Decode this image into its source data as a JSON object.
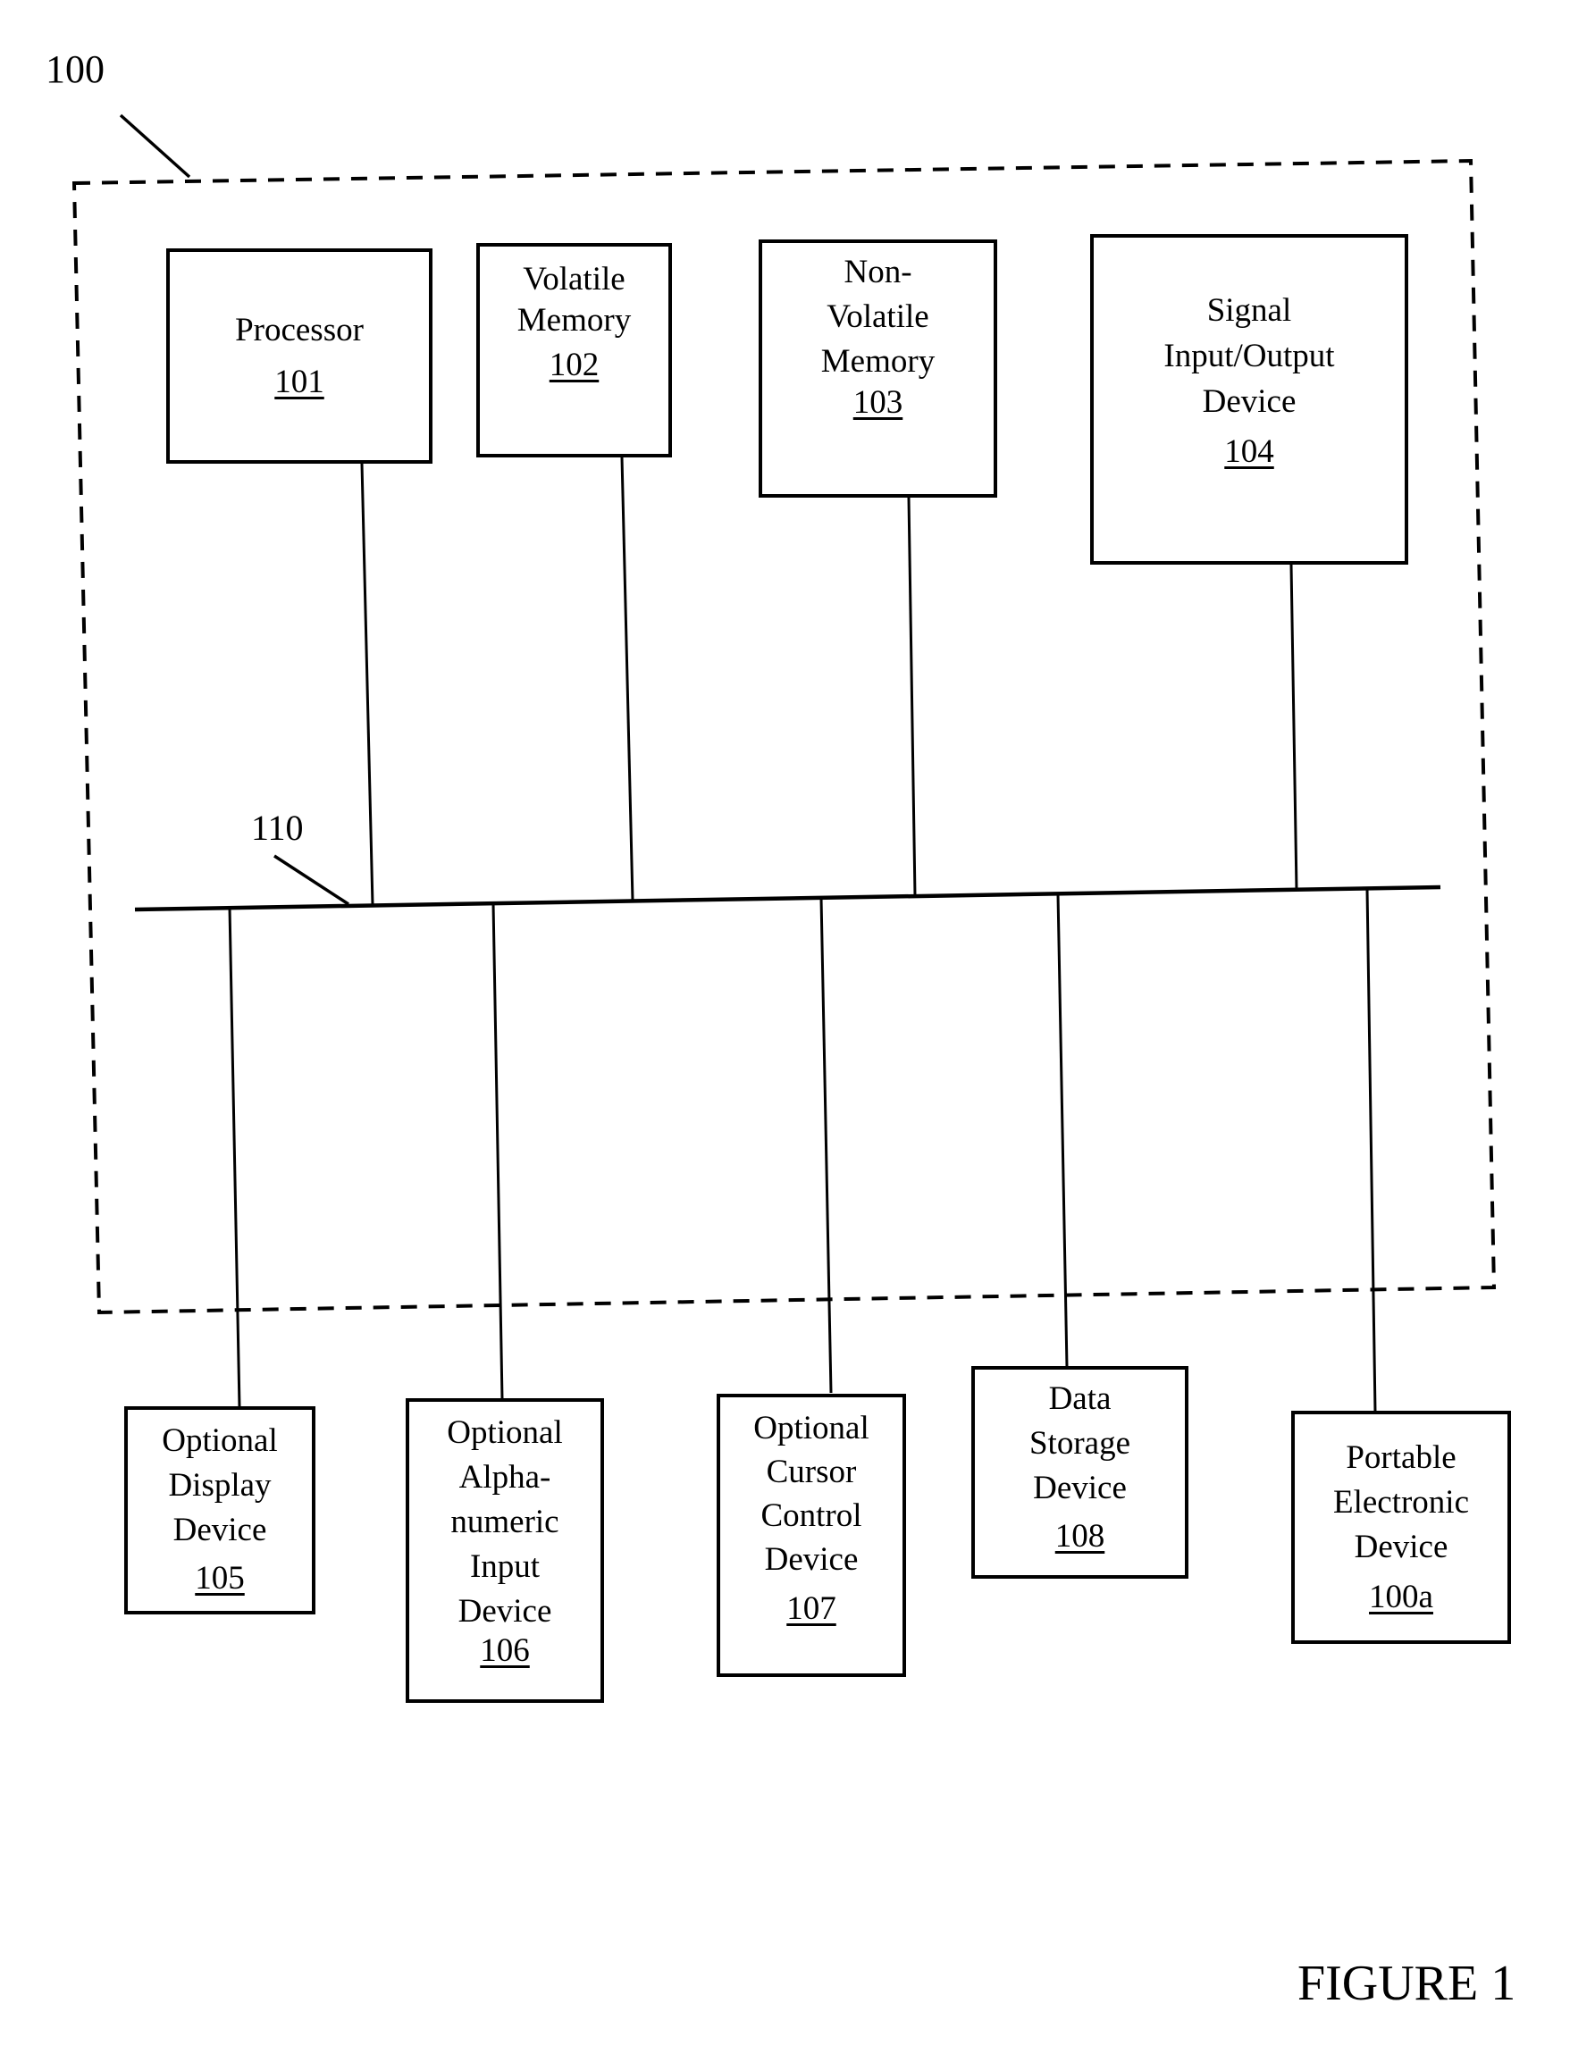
{
  "figure": {
    "system_ref": "100",
    "bus_ref": "110",
    "caption": "FIGURE 1"
  },
  "internal_components": [
    {
      "name": "Processor",
      "ref": "101"
    },
    {
      "name": "Volatile\nMemory",
      "ref": "102"
    },
    {
      "name": "Non-\nVolatile\nMemory",
      "ref": "103"
    },
    {
      "name": "Signal\nInput/Output\nDevice",
      "ref": "104"
    }
  ],
  "external_components": [
    {
      "name": "Optional\nDisplay\nDevice",
      "ref": "105"
    },
    {
      "name": "Optional\nAlpha-\nnumeric\nInput\nDevice",
      "ref": "106"
    },
    {
      "name": "Optional\nCursor\nControl\nDevice",
      "ref": "107"
    },
    {
      "name": "Data\nStorage\nDevice",
      "ref": "108"
    },
    {
      "name": "Portable\nElectronic\nDevice",
      "ref": "100a"
    }
  ],
  "colors": {
    "ink": "#000000",
    "paper": "#ffffff"
  }
}
